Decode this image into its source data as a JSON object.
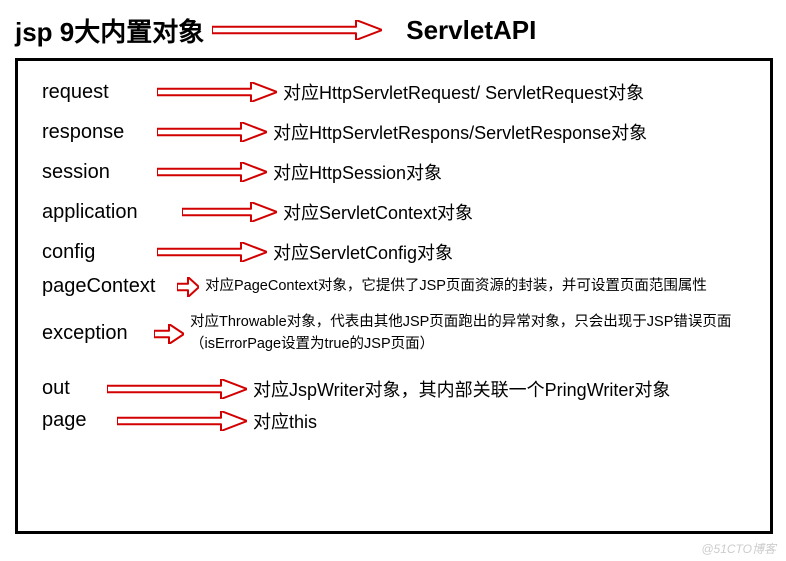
{
  "title_left": "jsp 9大内置对象",
  "title_right": "ServletAPI",
  "rows": [
    {
      "label": "request",
      "desc": "对应HttpServletRequest/ ServletRequest对象",
      "arrow_w": 120,
      "label_w": 115,
      "desc_small": false
    },
    {
      "label": "response",
      "desc": "对应HttpServletRespons/ServletResponse对象",
      "arrow_w": 110,
      "label_w": 115,
      "desc_small": false
    },
    {
      "label": "session",
      "desc": "对应HttpSession对象",
      "arrow_w": 110,
      "label_w": 115,
      "desc_small": false
    },
    {
      "label": "application",
      "desc": "对应ServletContext对象",
      "arrow_w": 95,
      "label_w": 140,
      "desc_small": false
    },
    {
      "label": "config",
      "desc": "对应ServletConfig对象",
      "arrow_w": 110,
      "label_w": 115,
      "desc_small": false
    },
    {
      "label": "pageContext",
      "desc": "对应PageContext对象，它提供了JSP页面资源的封装，并可设置页面范围属性",
      "arrow_w": 22,
      "label_w": 140,
      "desc_small": true
    },
    {
      "label": "exception",
      "desc": "对应Throwable对象，代表由其他JSP页面跑出的异常对象，只会出现于JSP错误页面（isErrorPage设置为true的JSP页面）",
      "arrow_w": 30,
      "label_w": 115,
      "desc_small": true
    },
    {
      "label": "out",
      "desc": "对应JspWriter对象，其内部关联一个PringWriter对象",
      "arrow_w": 140,
      "label_w": 75,
      "desc_small": false
    },
    {
      "label": "page",
      "desc": "对应this",
      "arrow_w": 130,
      "label_w": 75,
      "desc_small": false
    }
  ],
  "title_arrow_w": 170,
  "watermark": "@51CTO博客"
}
